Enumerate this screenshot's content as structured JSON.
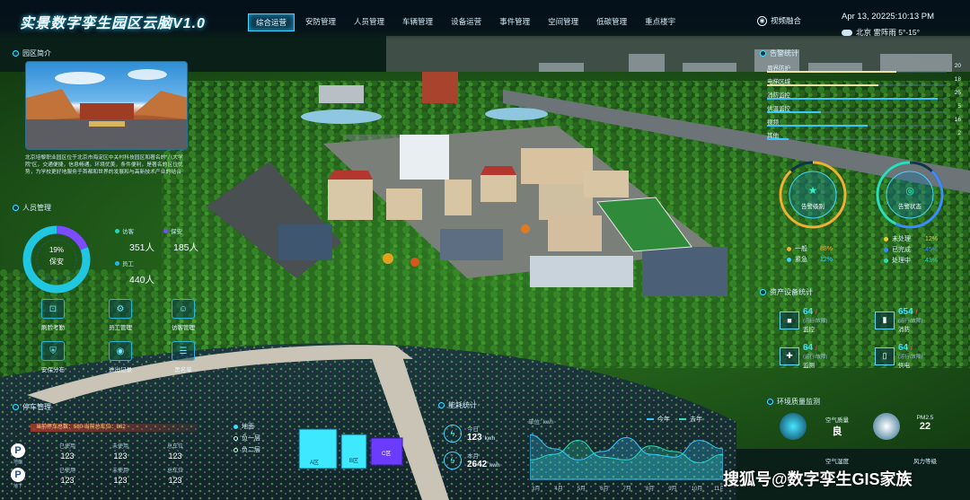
{
  "header": {
    "title": "实景数字孪生园区云脑V1.0",
    "tabs": [
      "综合运营",
      "安防管理",
      "人员管理",
      "车辆管理",
      "设备运营",
      "事件管理",
      "空间管理",
      "低碳管理",
      "重点楼宇"
    ],
    "active_tab": "综合运营",
    "video_btn": "视频融合",
    "datetime": "Apr 13, 20225:10:13 PM",
    "weather": "北京  雷阵雨  5°-15°"
  },
  "intro": {
    "title": "园区简介",
    "text": "北京培黎职业园区位于北京市海淀区中关村科技园区和著名的“八大学院”区，交通便捷，信息畅通，环境优美，条件便利，是著名的区位优势，为学校更好地服务于首都和世界的发展和与高新技术产业的结合"
  },
  "personnel": {
    "title": "人员管理",
    "donut_pct": "19%",
    "donut_label": "保安",
    "security_share": 0.19,
    "cats": [
      {
        "label": "访客",
        "value": "351人",
        "color": "#1fd6b8"
      },
      {
        "label": "保安",
        "value": "185人",
        "color": "#7b4cff"
      },
      {
        "label": "员工",
        "value": "440人",
        "color": "#1fb8e8"
      }
    ],
    "quick": [
      "刷脸考勤",
      "员工管理",
      "访客管理",
      "安保分布",
      "进出记录",
      "黑名单"
    ]
  },
  "parking": {
    "title": "停车管理",
    "bar": "当前停车总数：580      当前总车位：862",
    "rows": [
      {
        "icon": "P",
        "sub": "地面",
        "cells": [
          {
            "l": "已使用",
            "v": "123"
          },
          {
            "l": "未使用",
            "v": "123"
          },
          {
            "l": "总车位",
            "v": "123"
          }
        ]
      },
      {
        "icon": "P",
        "sub": "地下",
        "cells": [
          {
            "l": "已使用",
            "v": "123"
          },
          {
            "l": "未使用",
            "v": "123"
          },
          {
            "l": "总车位",
            "v": "123"
          }
        ]
      }
    ],
    "legend": [
      "地面",
      "负一层",
      "负二层"
    ],
    "zones": [
      "A区",
      "B区",
      "C区"
    ]
  },
  "energy": {
    "title": "能耗统计",
    "unit": "单位: kwh",
    "items": [
      {
        "l": "今日",
        "v": "123"
      },
      {
        "l": "本月",
        "v": "2642"
      }
    ],
    "val_units": [
      "kwh",
      "kwh"
    ],
    "legend": [
      "今年",
      "去年"
    ],
    "months": [
      "3月",
      "4月",
      "5月",
      "6月",
      "7月",
      "8月",
      "9月",
      "10月",
      "11月"
    ],
    "area_this": [
      0.8,
      0.55,
      0.35,
      0.5,
      0.75,
      0.45,
      0.4,
      0.7,
      0.55
    ],
    "area_last": [
      0.35,
      0.45,
      0.7,
      0.4,
      0.35,
      0.6,
      0.5,
      0.3,
      0.45
    ]
  },
  "alarm": {
    "title": "告警统计",
    "rows": [
      {
        "label": "周界防护",
        "value": "20",
        "pct": 0.72,
        "color": "#e8e6a0"
      },
      {
        "label": "电梯区域",
        "value": "18",
        "pct": 0.62,
        "color": "#e8e6a0"
      },
      {
        "label": "消防监控",
        "value": "25",
        "pct": 0.95,
        "color": "#36c8ff"
      },
      {
        "label": "供温监控",
        "value": "5",
        "pct": 0.3,
        "color": "#36c8ff"
      },
      {
        "label": "视频",
        "value": "16",
        "pct": 0.56,
        "color": "#36c8ff"
      },
      {
        "label": "其他",
        "value": "2",
        "pct": 0.12,
        "color": "#36c8ff"
      }
    ],
    "level_label": "告警级别",
    "level_share": 0.88,
    "state_label": "告警状态",
    "state_shares": [
      0.12,
      0.45,
      0.43
    ],
    "level_items": [
      {
        "label": "一般",
        "value": "88%",
        "color": "#f0b030"
      },
      {
        "label": "紧急",
        "value": "12%",
        "color": "#3ad0ff"
      }
    ],
    "state_items": [
      {
        "label": "未处理",
        "value": "12%",
        "color": "#f0d030"
      },
      {
        "label": "已完成",
        "value": "45%",
        "color": "#3a8cff"
      },
      {
        "label": "处理中",
        "value": "43%",
        "color": "#2ae0b8"
      }
    ]
  },
  "assets": {
    "title": "资产设备统计",
    "items": [
      {
        "n": "64",
        "total": "/",
        "sub": "(运行/故障)",
        "l": "监控",
        "ic": "📷"
      },
      {
        "n": "654",
        "total": "/",
        "sub": "(运行/故障)",
        "l": "消防",
        "ic": "🧯"
      },
      {
        "n": "64",
        "total": "/",
        "sub": "(运行/故障)",
        "l": "监测",
        "ic": "🚑"
      },
      {
        "n": "64",
        "total": "/",
        "sub": "(运行/故障)",
        "l": "供电",
        "ic": "🔋"
      }
    ]
  },
  "environment": {
    "title": "环境质量监测",
    "items": [
      {
        "l": "空气质量",
        "v": "良"
      },
      {
        "l": "PM2.5",
        "v": "22"
      },
      {
        "l": "空气湿度",
        "v": ""
      },
      {
        "l": "风力等级",
        "v": ""
      }
    ]
  },
  "watermark": "搜狐号@数字孪生GIS家族"
}
